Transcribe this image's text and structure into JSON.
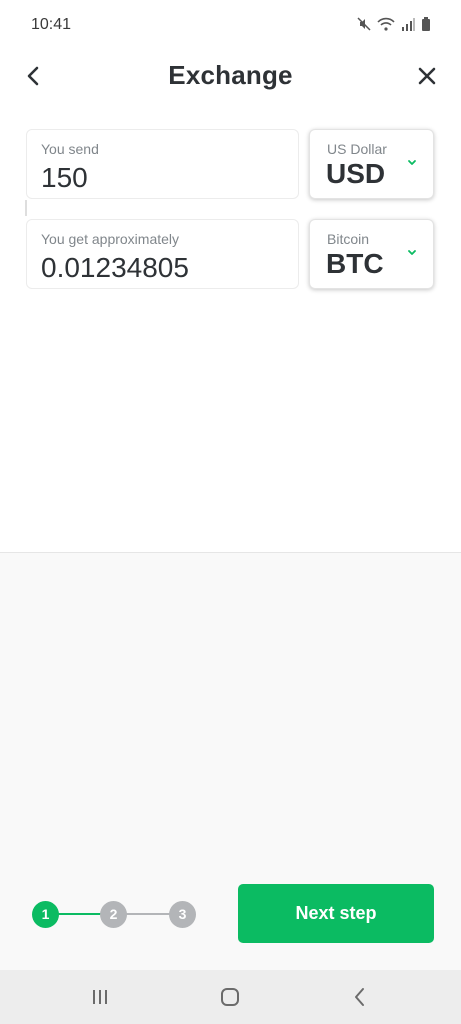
{
  "status_bar": {
    "time": "10:41",
    "icons": [
      "mute-icon",
      "wifi-icon",
      "signal-icon",
      "battery-icon"
    ]
  },
  "header": {
    "title": "Exchange",
    "back_icon": "chevron-left-icon",
    "close_icon": "close-icon"
  },
  "send": {
    "label": "You send",
    "amount": "150",
    "currency_name": "US Dollar",
    "currency_code": "USD"
  },
  "get": {
    "label": "You get approximately",
    "amount": "0.01234805",
    "currency_name": "Bitcoin",
    "currency_code": "BTC"
  },
  "stepper": {
    "steps": [
      "1",
      "2",
      "3"
    ],
    "active_step": 1,
    "active_color": "#0bbb62",
    "inactive_color": "#b3b5b8"
  },
  "actions": {
    "next_label": "Next step"
  },
  "colors": {
    "accent": "#0bbb62",
    "text": "#2e3236",
    "muted": "#80868b"
  },
  "nav_bar": {
    "icons": [
      "recent-apps-icon",
      "home-icon",
      "back-icon"
    ]
  }
}
